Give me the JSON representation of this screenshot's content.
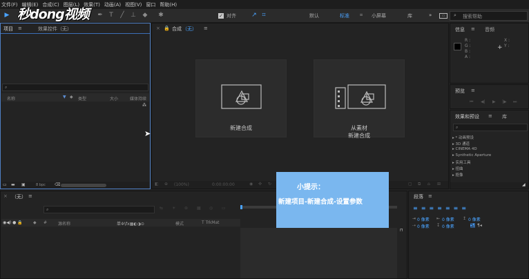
{
  "menu": [
    "文件(F)",
    "编辑(E)",
    "合成(C)",
    "图层(L)",
    "效果(T)",
    "动画(A)",
    "视图(V)",
    "窗口",
    "帮助(H)"
  ],
  "logo": {
    "text": "秒dong视频"
  },
  "toolbar": {
    "snap_label": "对齐",
    "workspaces": [
      "默认",
      "标准",
      "小屏幕",
      "库"
    ],
    "more": "»",
    "search_placeholder": "搜索帮助"
  },
  "project_panel": {
    "tab_project": "项目",
    "tab_effect_controls": "效果控件（无）",
    "col_name": "名称",
    "col_type": "类型",
    "col_size": "大小",
    "col_media": "媒体持续",
    "bpc": "8 bpc"
  },
  "comp_panel": {
    "tab": "合成",
    "tab_state": "（无）",
    "new_comp": "新建合成",
    "from_footage_line1": "从素材",
    "from_footage_line2": "新建合成",
    "zoom": "(100%)",
    "timecode": "0:00:00:00"
  },
  "info_panel": {
    "tab_info": "信息",
    "tab_audio": "音频",
    "r": "R :",
    "g": "G :",
    "b": "B :",
    "a": "A :",
    "x": "X :",
    "y": "Y :"
  },
  "preview_panel": {
    "tab": "预览"
  },
  "effects_panel": {
    "tab": "效果和预设",
    "tab_library": "库",
    "items": [
      "* 动画预设",
      "3D 通道",
      "CINEMA 4D",
      "Synthetic Aperture",
      "实用工具",
      "扭曲",
      "抠像"
    ]
  },
  "timeline": {
    "tab": "（无）",
    "col_source": "源名称",
    "col_mode": "模式",
    "col_trkmat": "T  TrkMat"
  },
  "paragraph_panel": {
    "tab": "段落",
    "units": [
      "0 像素",
      "0 像素",
      "0 像素",
      "0 像素",
      "0 像素"
    ]
  },
  "tip": {
    "title": "小提示：",
    "body": "新建项目-新建合成-设置参数"
  }
}
